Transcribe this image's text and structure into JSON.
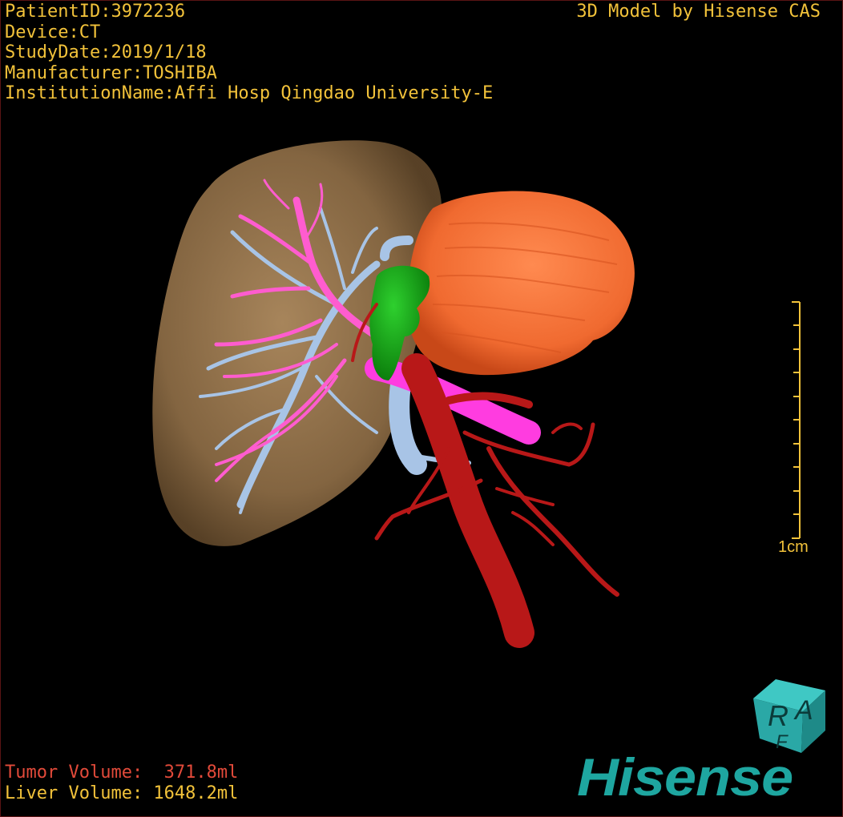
{
  "info": {
    "patient_id": "PatientID:3972236",
    "device": "Device:CT",
    "study_date": "StudyDate:2019/1/18",
    "manufacturer": "Manufacturer:TOSHIBA",
    "institution": "InstitutionName:Affi Hosp Qingdao University-E"
  },
  "title": "3D Model by Hisense CAS",
  "volumes": {
    "tumor": "Tumor Volume:  371.8ml",
    "liver": "Liver Volume: 1648.2ml"
  },
  "scale_bar": {
    "label": "1cm"
  },
  "orientation_cube": {
    "letters": [
      "R",
      "A",
      "F"
    ]
  },
  "logo": {
    "text": "Hisense"
  },
  "colors": {
    "text": "#f2c23a",
    "tumor_text": "#e24a3a",
    "liver": "#9c7b52",
    "tumor": "#f06a30",
    "hepatic_vein": "#ff5ccf",
    "portal_vein": "#a8c4e6",
    "artery": "#b81818",
    "green_structure": "#12a012",
    "logo": "#1ea6a0"
  }
}
